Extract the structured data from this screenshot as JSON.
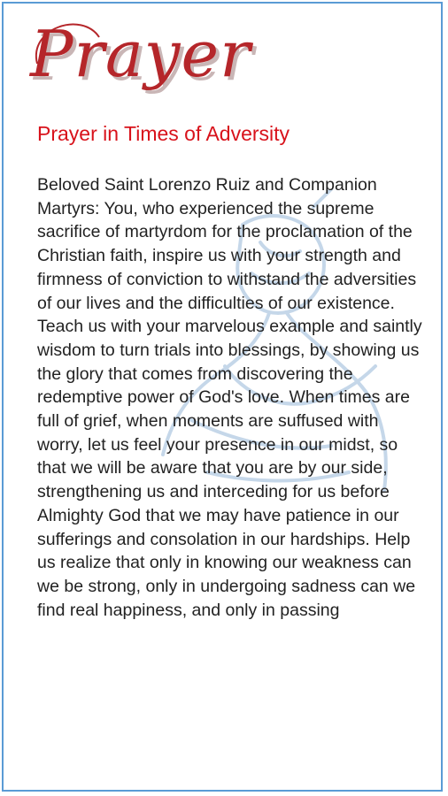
{
  "header": {
    "logo_text": "Prayer"
  },
  "prayer": {
    "title": "Prayer in Times of Adversity",
    "body": "Beloved Saint Lorenzo Ruiz and Companion Martyrs: You, who experienced the supreme sacrifice of martyrdom for the proclamation of the Christian faith, inspire us with your strength and firmness of conviction to withstand the adversities of our lives and the difficulties of our existence. Teach us with your marvelous example and saintly wisdom to turn trials into blessings, by showing us the glory that comes from discovering the redemptive power of God's love. When times are full of grief, when moments are suffused with worry, let us feel your presence in our midst, so that we will be aware that you are by our side, strengthening us and interceding for us before Almighty God that we may have patience in our sufferings and consolation in our hardships. Help us realize that only in knowing our weakness can we be strong, only in undergoing sadness can we find real happiness, and only in passing"
  },
  "colors": {
    "border": "#5a9bd5",
    "logo": "#b5262a",
    "title": "#d8121b",
    "text": "#222222",
    "watermark": "#7fa7cf"
  }
}
